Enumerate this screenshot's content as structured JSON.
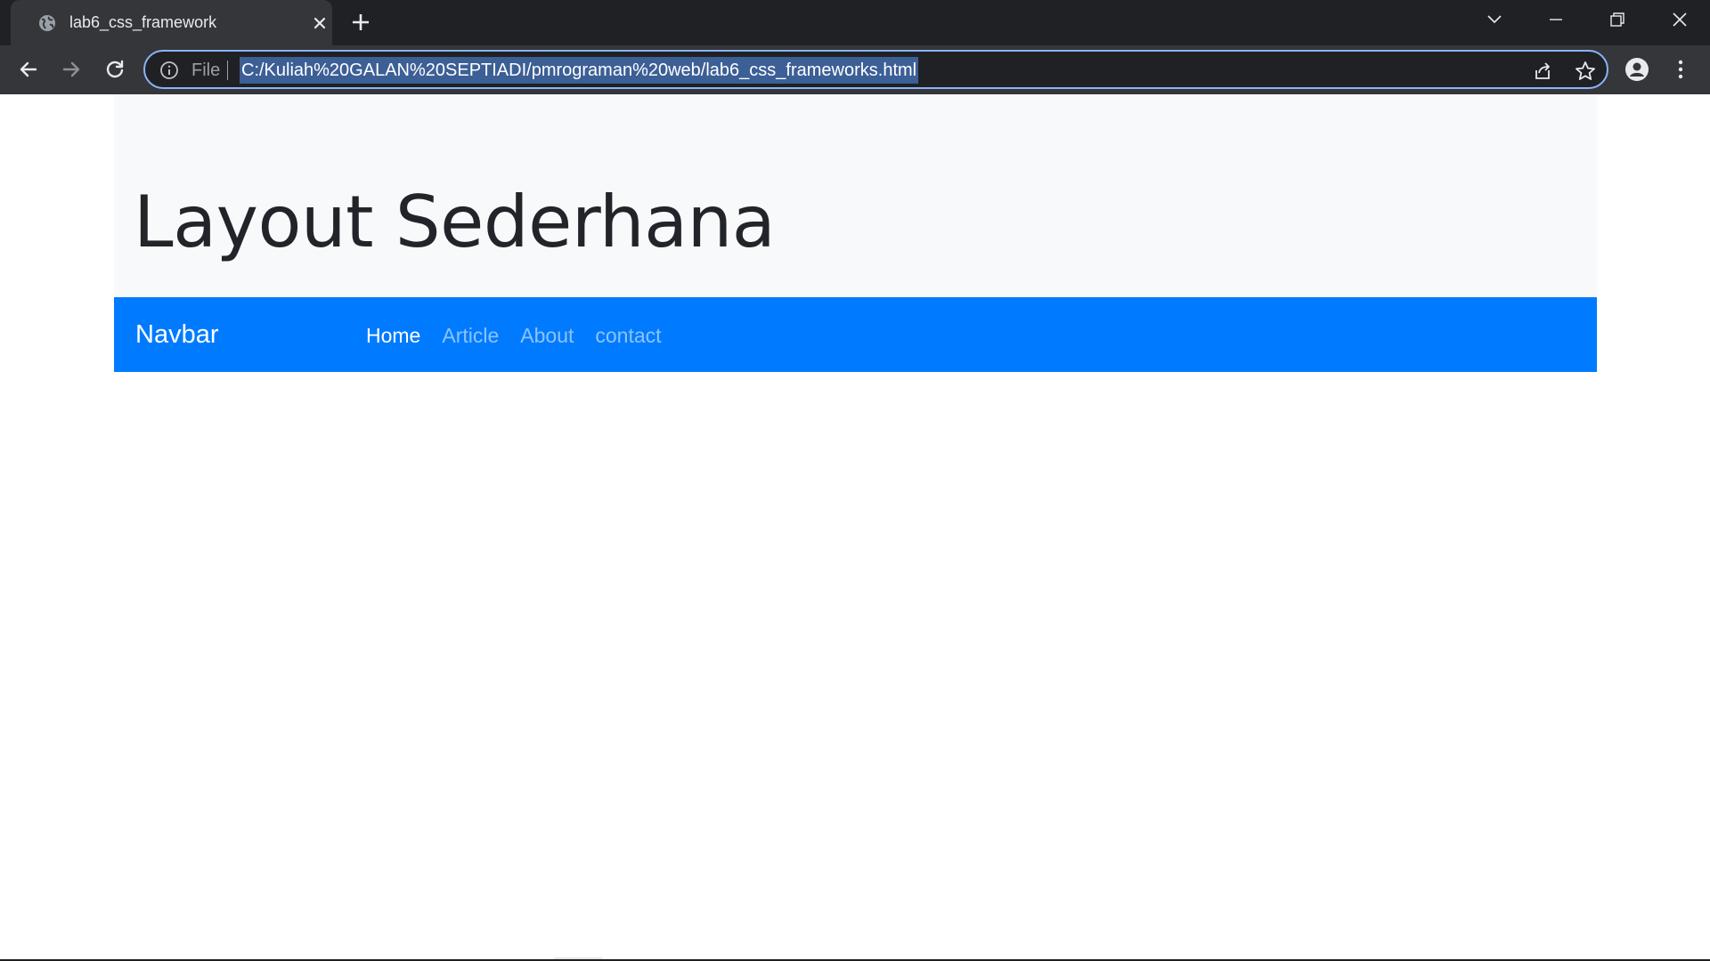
{
  "browser": {
    "tab": {
      "title": "lab6_css_framework",
      "favicon": "globe-icon",
      "close_icon": "close-icon"
    },
    "new_tab_icon": "plus-icon",
    "window_controls": [
      "chevron-down-icon",
      "minimize-icon",
      "restore-icon",
      "close-icon"
    ],
    "toolbar": {
      "back_icon": "arrow-left-icon",
      "forward_icon": "arrow-right-icon",
      "reload_icon": "reload-icon",
      "scheme_label": "File",
      "url": "C:/Kuliah%20GALAN%20SEPTIADI/pmrograman%20web/lab6_css_frameworks.html",
      "share_icon": "share-icon",
      "bookmark_icon": "star-icon",
      "profile_icon": "person-icon",
      "menu_icon": "kebab-menu-icon"
    },
    "colors": {
      "tabstrip": "#202124",
      "toolbar": "#35363a",
      "focus_ring": "#8ab4f8",
      "url_selection": "#3c5f96"
    }
  },
  "page": {
    "jumbotron": {
      "title": "Layout Sederhana"
    },
    "navbar": {
      "brand": "Navbar",
      "links": [
        {
          "label": "Home",
          "active": true
        },
        {
          "label": "Article",
          "active": false
        },
        {
          "label": "About",
          "active": false
        },
        {
          "label": "contact",
          "active": false
        }
      ]
    },
    "colors": {
      "navbar_bg": "#007bff",
      "jumbotron_bg": "#f8f9fa",
      "title_text": "#212529"
    }
  }
}
